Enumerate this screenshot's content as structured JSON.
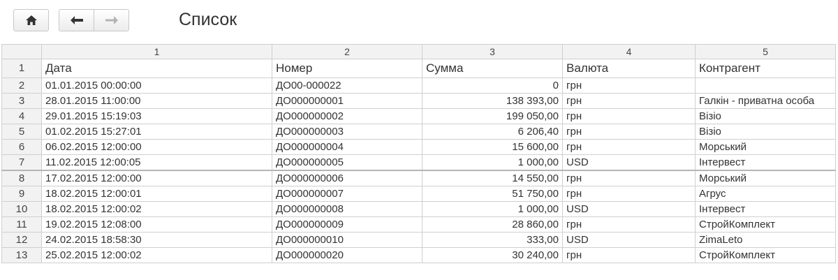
{
  "toolbar": {
    "title": "Список",
    "home_icon": "home-icon",
    "back_icon": "arrow-left-icon",
    "forward_icon": "arrow-right-icon"
  },
  "table": {
    "column_numbers": [
      "1",
      "2",
      "3",
      "4",
      "5"
    ],
    "header_row_number": "1",
    "header": [
      "Дата",
      "Номер",
      "Сумма",
      "Валюта",
      "Контрагент"
    ],
    "rows": [
      {
        "n": "2",
        "date": "01.01.2015 00:00:00",
        "number": "ДО00-000022",
        "sum": "0",
        "currency": "грн",
        "counterparty": ""
      },
      {
        "n": "3",
        "date": "28.01.2015 11:00:00",
        "number": "ДО000000001",
        "sum": "138 393,00",
        "currency": "грн",
        "counterparty": "Галкін - приватна особа"
      },
      {
        "n": "4",
        "date": "29.01.2015 15:19:03",
        "number": "ДО000000002",
        "sum": "199 050,00",
        "currency": "грн",
        "counterparty": "Візіо"
      },
      {
        "n": "5",
        "date": "01.02.2015 15:27:01",
        "number": "ДО000000003",
        "sum": "6 206,40",
        "currency": "грн",
        "counterparty": "Візіо"
      },
      {
        "n": "6",
        "date": "06.02.2015 12:00:00",
        "number": "ДО000000004",
        "sum": "15 600,00",
        "currency": "грн",
        "counterparty": "Морський"
      },
      {
        "n": "7",
        "date": "11.02.2015 12:00:05",
        "number": "ДО000000005",
        "sum": "1 000,00",
        "currency": "USD",
        "counterparty": "Інтервест"
      },
      {
        "n": "8",
        "date": "17.02.2015 12:00:00",
        "number": "ДО000000006",
        "sum": "14 550,00",
        "currency": "грн",
        "counterparty": "Морський"
      },
      {
        "n": "9",
        "date": "18.02.2015 12:00:01",
        "number": "ДО000000007",
        "sum": "51 750,00",
        "currency": "грн",
        "counterparty": "Агрус"
      },
      {
        "n": "10",
        "date": "18.02.2015 12:00:02",
        "number": "ДО000000008",
        "sum": "1 000,00",
        "currency": "USD",
        "counterparty": "Інтервест"
      },
      {
        "n": "11",
        "date": "19.02.2015 12:08:00",
        "number": "ДО000000009",
        "sum": "28 860,00",
        "currency": "грн",
        "counterparty": "СтройКомплект"
      },
      {
        "n": "12",
        "date": "24.02.2015 18:58:30",
        "number": "ДО000000010",
        "sum": "333,00",
        "currency": "USD",
        "counterparty": "ZimaLeto"
      },
      {
        "n": "13",
        "date": "25.02.2015 12:00:02",
        "number": "ДО000000020",
        "sum": "30 240,00",
        "currency": "грн",
        "counterparty": "СтройКомплект"
      }
    ]
  }
}
